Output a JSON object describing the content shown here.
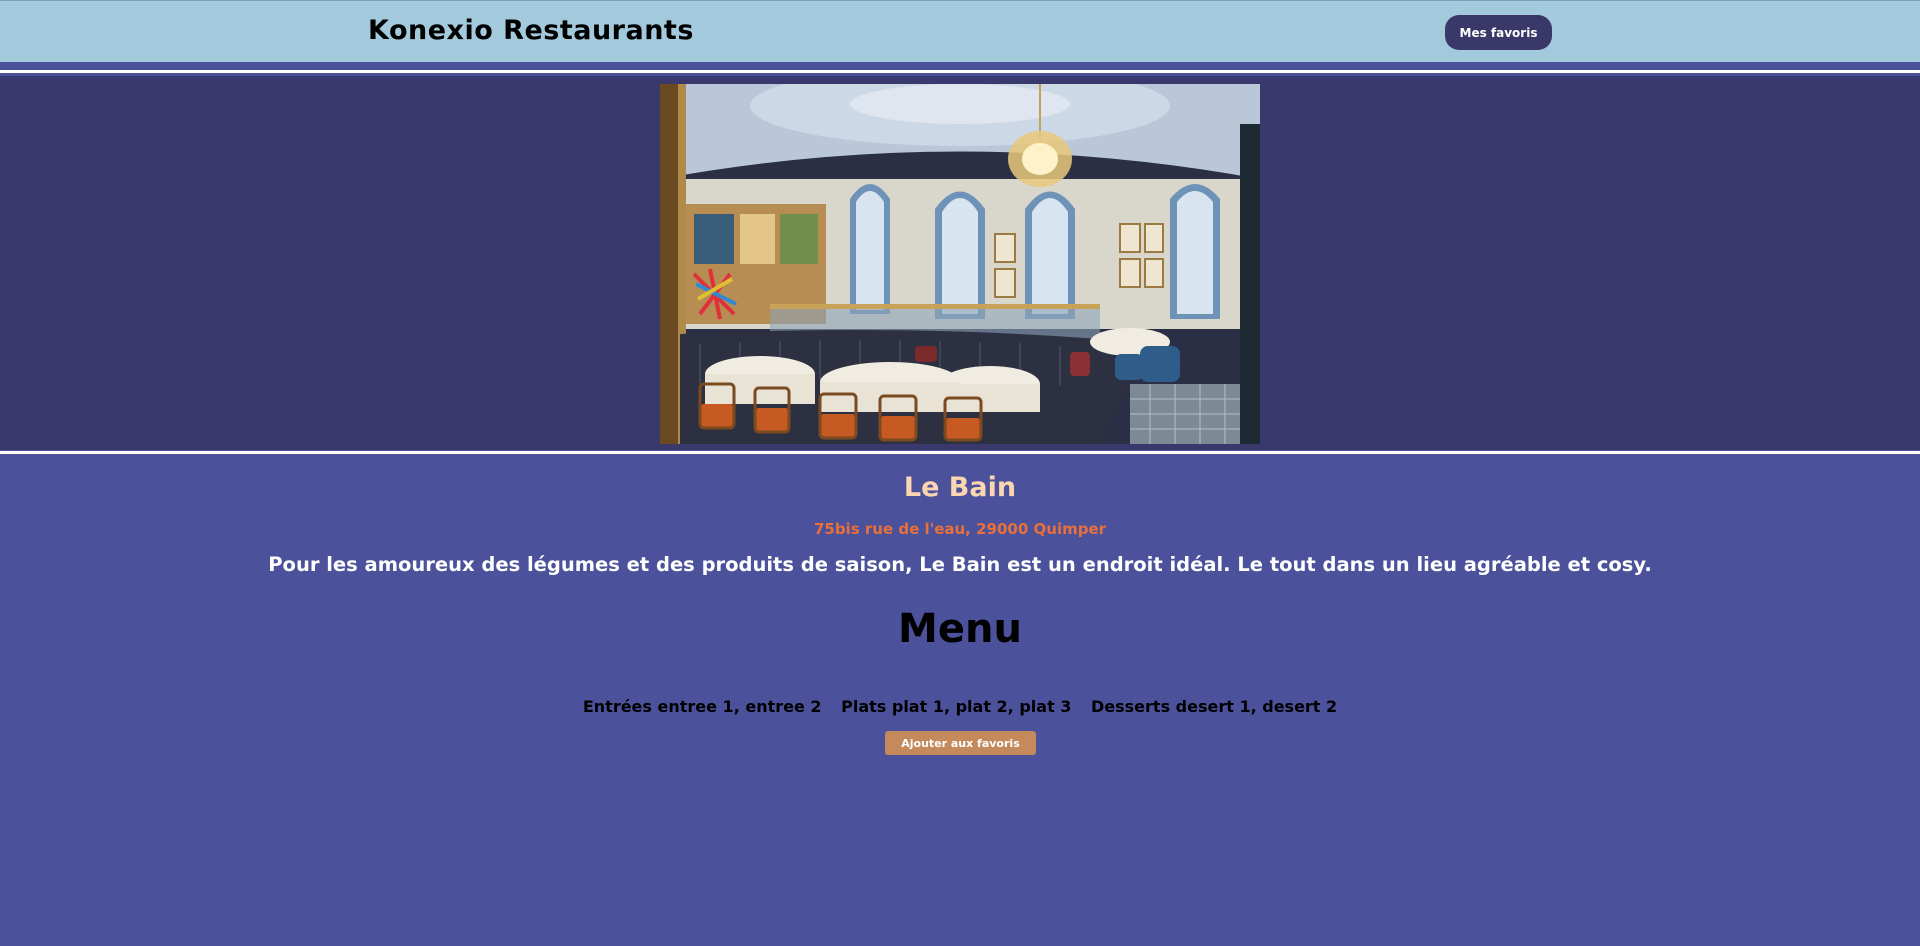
{
  "header": {
    "brand": "Konexio Restaurants",
    "favorites_button": "Mes favoris"
  },
  "hero": {
    "image_alt": "restaurant dining room photo"
  },
  "restaurant": {
    "name": "Le Bain",
    "address": "75bis rue de l'eau, 29000 Quimper",
    "description": "Pour les amoureux des légumes et des produits de saison, Le Bain est un endroit idéal. Le tout dans un lieu agréable et cosy."
  },
  "menu": {
    "title": "Menu",
    "starters": "Entrées entree 1, entree 2",
    "mains": "Plats plat 1, plat 2, plat 3",
    "desserts": "Desserts desert 1, desert 2"
  },
  "actions": {
    "add_favorite": "Ajouter aux favoris"
  },
  "colors": {
    "header_bg": "#a3c9dc",
    "hero_bg": "#3a396e",
    "page_bg": "#4b519b",
    "name_color": "#fcd6b0",
    "address_color": "#e8703a",
    "button_dark": "#3a3869",
    "button_accent": "#c48a5c"
  }
}
